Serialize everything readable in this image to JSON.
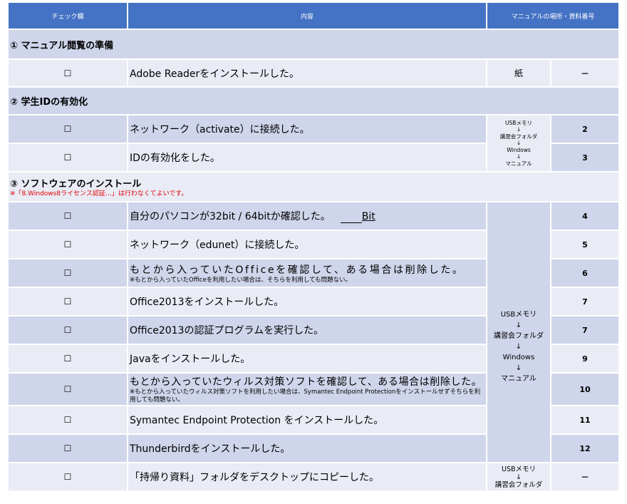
{
  "header": {
    "check_col": "チェック欄",
    "content_col": "内容",
    "location_col": "マニュアルの場所・資料番号"
  },
  "checkbox_glyph": "☐",
  "arrow": "↓",
  "sections": {
    "s1": {
      "title": "① マニュアル閲覧の準備"
    },
    "s2": {
      "title": "② 学生IDの有効化"
    },
    "s3": {
      "title": "③ ソフトウェアのインストール",
      "note": "※「8.Windows8ライセンス認証…」は行わなくてよいです。"
    }
  },
  "rows": {
    "adobe": {
      "text": "Adobe Readerをインストールした。",
      "location": "紙",
      "number": "－"
    },
    "activate": {
      "text": "ネットワーク（activate）に接続した。",
      "number": "2"
    },
    "idenable": {
      "text": "IDの有効化をした。",
      "number": "3"
    },
    "bit": {
      "text": "自分のパソコンが32bit / 64bitか確認した。",
      "suffix": "Bit",
      "number": "4"
    },
    "edunet": {
      "text": "ネットワーク（edunet）に接続した。",
      "number": "5"
    },
    "officeremove": {
      "text": "もとから入っていたOfficeを確認して、ある場合は削除した。",
      "sub": "※もとから入っていたOfficeを利用したい場合は、そちらを利用しても問題ない。",
      "number": "6"
    },
    "office2013": {
      "text": "Office2013をインストールした。",
      "number": "7"
    },
    "officeauth": {
      "text": "Office2013の認証プログラムを実行した。",
      "number": "7"
    },
    "java": {
      "text": "Javaをインストールした。",
      "number": "9"
    },
    "avremove": {
      "text": "もとから入っていたウィルス対策ソフトを確認して、ある場合は削除した。",
      "sub": "※もとから入っていたウィルス対策ソフトを利用したい場合は、Symantec Endpoint Protectionをインストールせずそちらを利用しても問題ない。",
      "number": "10"
    },
    "symantec": {
      "text": "Symantec Endpoint Protection をインストールした。",
      "number": "11"
    },
    "thunderbird": {
      "text": "Thunderbirdをインストールした。",
      "number": "12"
    },
    "copy": {
      "text": "「持帰り資料」フォルダをデスクトップにコピーした。",
      "number": "－"
    }
  },
  "locations": {
    "usb": "USBメモリ",
    "folder": "講習会フォルダ",
    "windows": "Windows",
    "manual": "マニュアル"
  }
}
